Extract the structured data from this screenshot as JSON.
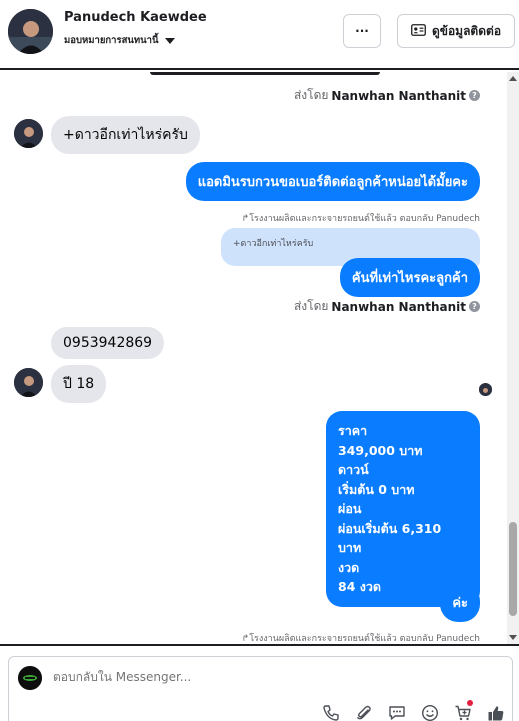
{
  "header": {
    "name": "Panudech Kaewdee",
    "assign_label": "มอบหมายการสนทนานี้",
    "more_label": "···",
    "contact_label": "ดูข้อมูลติดต่อ"
  },
  "chat": {
    "sent_by_1": {
      "prefix": "ส่งโดย",
      "name": "Nanwhan Nanthanit"
    },
    "msg_in_1": "+ดาวอีกเท่าไหร่ครับ",
    "msg_out_1": "แอดมินรบกวนขอเบอร์ติดต่อลูกค้าหน่อยได้มั้ยคะ",
    "reply_note_1": "โรงงานผลิตและกระจายรถยนต์ใช้แล้ว ตอบกลับ Panudech",
    "quoted_text": "+ดาวอีกเท่าไหร่ครับ",
    "msg_out_2": "คันที่เท่าไหรคะลูกค้า",
    "sent_by_2": {
      "prefix": "ส่งโดย",
      "name": "Nanwhan Nanthanit"
    },
    "msg_in_2": "0953942869",
    "msg_in_3": "ปี 18",
    "msg_out_multi": [
      "ราคา",
      "349,000 บาท",
      "ดาวน์",
      "เริ่มต้น 0 บาท",
      "ผ่อน",
      "ผ่อนเริ่มต้น 6,310 บาท",
      "งวด",
      "84 งวด"
    ],
    "msg_out_3": "ค่ะ",
    "reply_note_2": "โรงงานผลิตและกระจายรถยนต์ใช้แล้ว ตอบกลับ Panudech",
    "info_icon_glyph": "?"
  },
  "composer": {
    "placeholder": "ตอบกลับใน Messenger..."
  },
  "colors": {
    "outgoing_bubble": "#0a7cff",
    "incoming_bubble": "#e4e6eb",
    "quoted_bubble": "#cfe2fc"
  }
}
